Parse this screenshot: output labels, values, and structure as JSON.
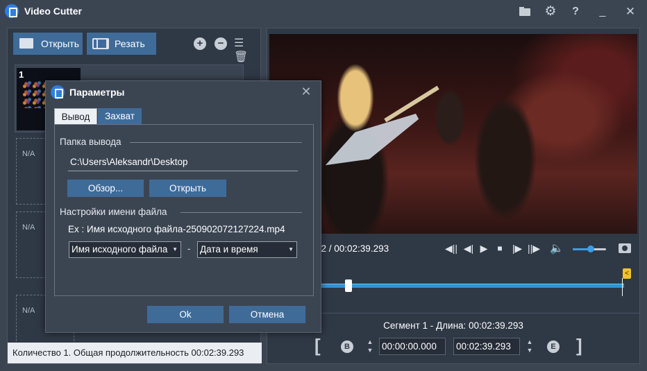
{
  "app": {
    "title": "Video Cutter"
  },
  "toolbar": {
    "open_label": "Открыть",
    "cut_label": "Резать",
    "add_symbol": "+",
    "remove_symbol": "−",
    "clear_symbol": "☰🗑"
  },
  "clip_list": {
    "items": [
      {
        "number": "1"
      }
    ],
    "placeholders": [
      "N/A",
      "N/A",
      "N/A"
    ]
  },
  "status_bar": {
    "text": "Количество 1. Общая продолжительность 00:02:39.293"
  },
  "player": {
    "time_display": "72 / 00:02:39.293",
    "volume_level": 0.55
  },
  "segment": {
    "label": "Сегмент 1 - Длина: 00:02:39.293",
    "start_time": "00:00:00.000",
    "end_time": "00:02:39.293",
    "begin_badge": "B",
    "end_badge": "E"
  },
  "dialog": {
    "title": "Параметры",
    "tabs": [
      {
        "label": "Вывод",
        "active": true
      },
      {
        "label": "Захват",
        "active": false
      }
    ],
    "output_folder": {
      "title": "Папка вывода",
      "path": "C:\\Users\\Aleksandr\\Desktop",
      "browse_label": "Обзор...",
      "open_label": "Открыть"
    },
    "filename_settings": {
      "title": "Настройки имени файла",
      "example": "Ex : Имя исходного файла-250902072127224.mp4",
      "select_1": "Имя исходного файла",
      "separator": "-",
      "select_2": "Дата и время"
    },
    "ok_label": "Ok",
    "cancel_label": "Отмена"
  },
  "colors": {
    "accent": "#3f6b99",
    "timeline": "#2f92d9",
    "end_marker": "#f2c12e"
  }
}
